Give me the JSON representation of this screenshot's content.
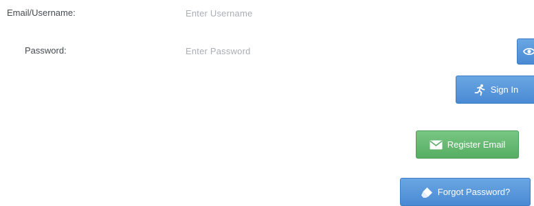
{
  "form": {
    "email_label": "Email/Username:",
    "email_placeholder": "Enter Username",
    "password_label": "Password:",
    "password_placeholder": "Enter Password"
  },
  "buttons": {
    "show_password_icon": "eye-icon",
    "sign_in": {
      "label": "Sign In",
      "icon": "running-person-icon"
    },
    "register": {
      "label": "Register Email",
      "icon": "envelope-icon"
    },
    "forgot": {
      "label": "Forgot Password?",
      "icon": "eraser-icon"
    }
  },
  "colors": {
    "primary_button": "#4a8ad3",
    "success_button": "#56ad63",
    "label_text": "#444a50",
    "placeholder_text": "#a9aeb3"
  }
}
